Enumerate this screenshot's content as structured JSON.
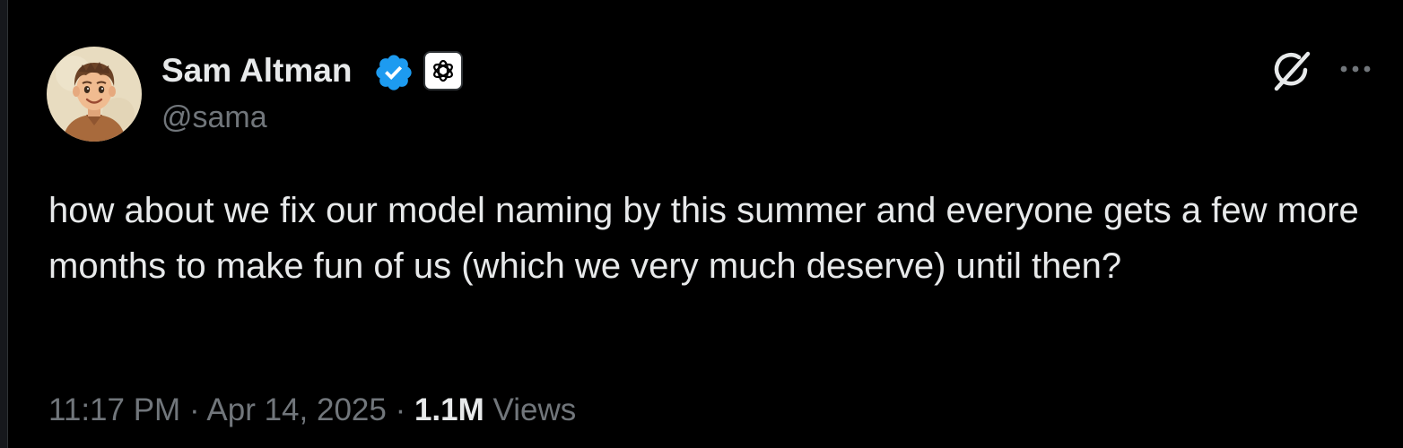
{
  "author": {
    "name": "Sam Altman",
    "handle": "@sama",
    "verified": true,
    "affiliate": "openai-logo-icon",
    "avatar": "illustrated-portrait-avatar"
  },
  "actions": {
    "grok_icon": "grok-icon",
    "more_icon": "more-options-icon"
  },
  "tweet": {
    "text": "how about we fix our model naming by this summer and everyone gets a few more months to make fun of us (which we very much deserve) until then?"
  },
  "meta": {
    "time": "11:17 PM",
    "separator1": "·",
    "date": "Apr 14, 2025",
    "separator2": "·",
    "views_count": "1.1M",
    "views_label": "Views"
  },
  "colors": {
    "background": "#000000",
    "text_primary": "#e7e9ea",
    "text_secondary": "#71767b",
    "verified_blue": "#1d9bf0"
  }
}
